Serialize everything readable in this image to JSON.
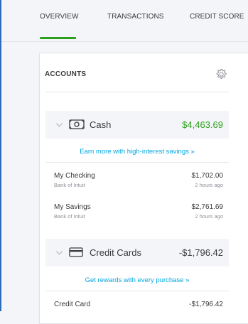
{
  "tabs": [
    {
      "label": "OVERVIEW",
      "active": true
    },
    {
      "label": "TRANSACTIONS",
      "active": false
    },
    {
      "label": "CREDIT SCORE",
      "active": false
    }
  ],
  "accounts_card": {
    "title": "ACCOUNTS",
    "settings_icon": "gear-icon",
    "groups": [
      {
        "label": "Cash",
        "icon": "cash-icon",
        "amount": "$4,463.69",
        "amount_color": "#2ca01c",
        "promo": "Earn more with high-interest savings »",
        "accounts": [
          {
            "name": "My Checking",
            "bank": "Bank of Intuit",
            "amount": "$1,702.00",
            "updated": "2 hours ago"
          },
          {
            "name": "My Savings",
            "bank": "Bank of Intuit",
            "amount": "$2,761.69",
            "updated": "2 hours ago"
          }
        ]
      },
      {
        "label": "Credit Cards",
        "icon": "credit-card-icon",
        "amount": "-$1,796.42",
        "amount_color": "#393a3d",
        "promo": "Get rewards with every purchase »",
        "accounts": [
          {
            "name": "Credit Card",
            "bank": "",
            "amount": "-$1,796.42",
            "updated": ""
          }
        ]
      }
    ]
  },
  "colors": {
    "accent_green": "#2ca01c",
    "link_blue": "#00a6e0",
    "window_border": "#2b6cb5"
  }
}
